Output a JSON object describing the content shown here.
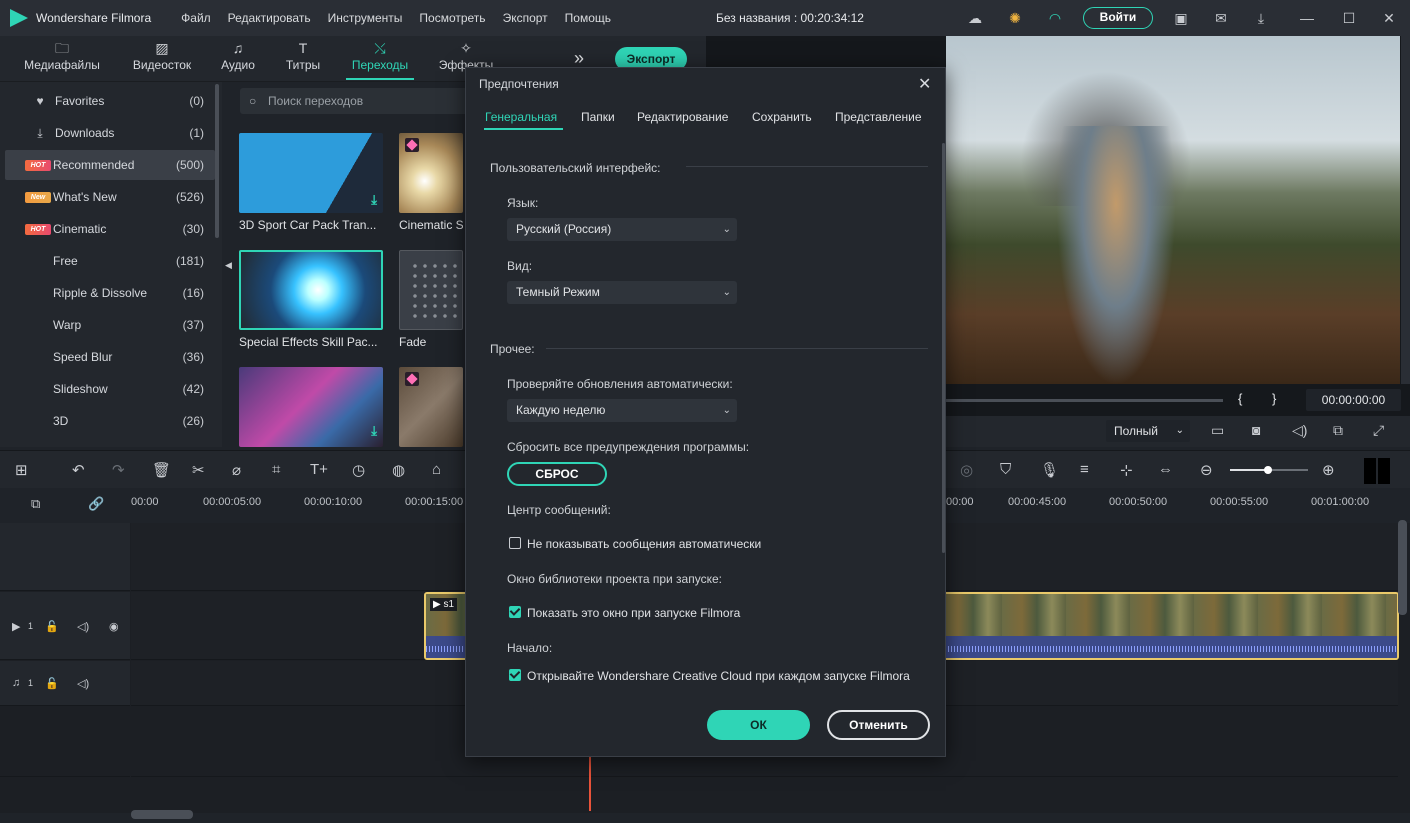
{
  "app": {
    "name": "Wondershare Filmora",
    "project_title": "Без названия : 00:20:34:12"
  },
  "menu": [
    "Файл",
    "Редактировать",
    "Инструменты",
    "Посмотреть",
    "Экспорт",
    "Помощь"
  ],
  "titlebar": {
    "login_label": "Войти"
  },
  "top_tabs": [
    {
      "label": "Медиафайлы",
      "icon": "folder-icon"
    },
    {
      "label": "Видеосток",
      "icon": "image-icon"
    },
    {
      "label": "Аудио",
      "icon": "music-note-icon"
    },
    {
      "label": "Титры",
      "icon": "text-icon"
    },
    {
      "label": "Переходы",
      "icon": "transition-icon"
    },
    {
      "label": "Эффекты",
      "icon": "effects-icon"
    }
  ],
  "export_label": "Экспорт",
  "sidebar": {
    "items": [
      {
        "label": "Favorites",
        "count": "(0)",
        "icon": "heart-icon"
      },
      {
        "label": "Downloads",
        "count": "(1)",
        "icon": "download-icon"
      },
      {
        "label": "Recommended",
        "count": "(500)",
        "badge": "HOT"
      },
      {
        "label": "What's New",
        "count": "(526)",
        "badge": "New"
      },
      {
        "label": "Cinematic",
        "count": "(30)",
        "badge": "HOT"
      },
      {
        "label": "Free",
        "count": "(181)"
      },
      {
        "label": "Ripple & Dissolve",
        "count": "(16)"
      },
      {
        "label": "Warp",
        "count": "(37)"
      },
      {
        "label": "Speed Blur",
        "count": "(36)"
      },
      {
        "label": "Slideshow",
        "count": "(42)"
      },
      {
        "label": "3D",
        "count": "(26)"
      }
    ]
  },
  "content": {
    "search_placeholder": "Поиск переходов",
    "thumbs": [
      {
        "label": "3D Sport Car Pack Tran..."
      },
      {
        "label": "Cinematic S"
      },
      {
        "label": "Special Effects Skill Pac..."
      },
      {
        "label": "Fade"
      }
    ]
  },
  "preview": {
    "timecode": "00:00:00:00",
    "quality": "Полный",
    "brace_open": "{",
    "brace_close": "}"
  },
  "ruler": [
    "00:00",
    "00:00:05:00",
    "00:00:10:00",
    "00:00:15:00",
    "00:00",
    "00:00:45:00",
    "00:00:50:00",
    "00:00:55:00",
    "00:01:00:00"
  ],
  "tracks": {
    "video_num": "1",
    "audio_num": "1",
    "clip_label": "s1"
  },
  "dialog": {
    "title": "Предпочтения",
    "tabs": [
      "Генеральная",
      "Папки",
      "Редактирование",
      "Сохранить",
      "Представление"
    ],
    "section_ui": "Пользовательский интерфейс:",
    "lang_label": "Язык:",
    "lang_value": "Русский (Россия)",
    "view_label": "Вид:",
    "view_value": "Темный Режим",
    "section_other": "Прочее:",
    "update_label": "Проверяйте обновления автоматически:",
    "update_value": "Каждую неделю",
    "reset_label": "Сбросить все предупреждения программы:",
    "reset_btn": "СБРОС",
    "msg_center": "Центр сообщений:",
    "msg_chk": "Не показывать сообщения автоматически",
    "lib_label": "Окно библиотеки проекта при запуске:",
    "lib_chk": "Показать это окно при запуске Filmora",
    "start_label": "Начало:",
    "start_chk": "Открывайте Wondershare Creative Cloud при каждом запуске Filmora",
    "ok": "ОК",
    "cancel": "Отменить"
  },
  "colors": {
    "accent": "#2fd5b6",
    "bg": "#1f2329",
    "clip_border": "#e9c96a",
    "playhead": "#e8533a"
  }
}
